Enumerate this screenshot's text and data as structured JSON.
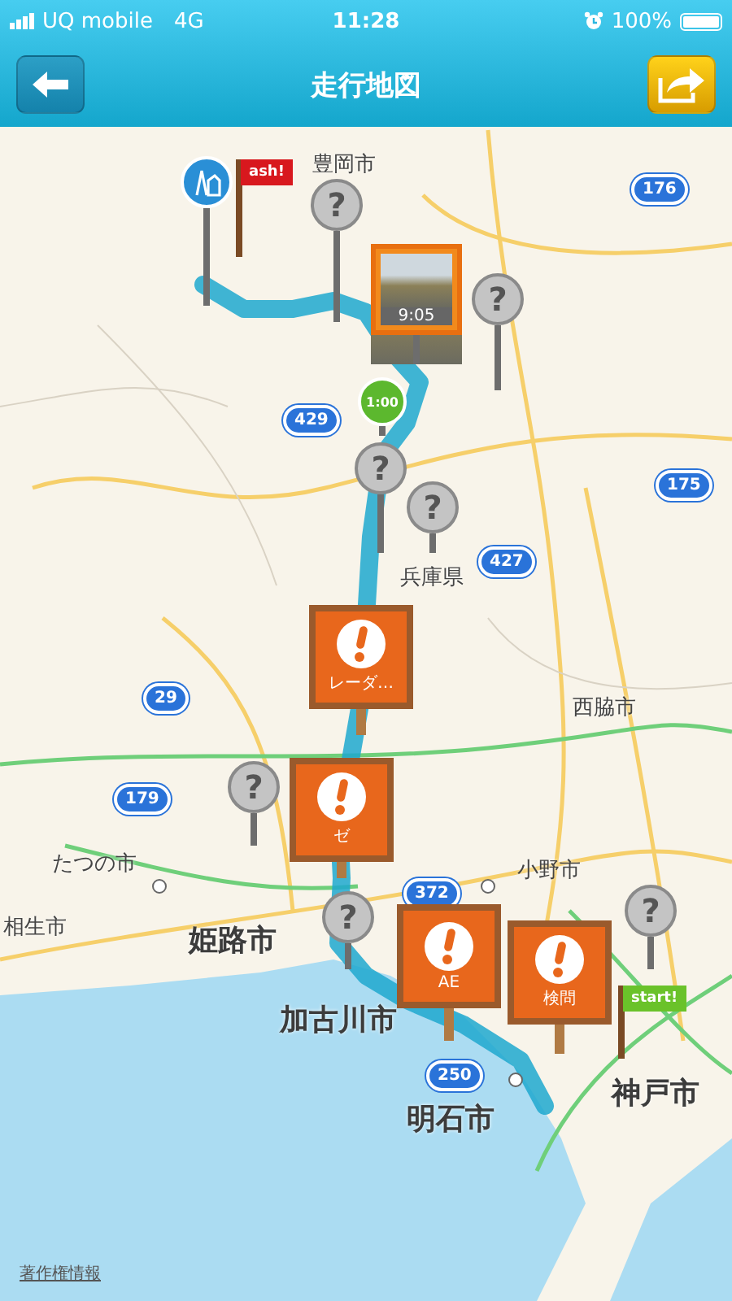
{
  "status_bar": {
    "carrier": "UQ mobile",
    "network": "4G",
    "time": "11:28",
    "battery": "100%"
  },
  "nav": {
    "title": "走行地図"
  },
  "map": {
    "city_labels": [
      "豊岡市",
      "兵庫県",
      "西脇市",
      "たつの市",
      "小野市",
      "相生市",
      "姫路市",
      "加古川市",
      "明石市",
      "神戸市"
    ],
    "route_shields": [
      "176",
      "429",
      "175",
      "427",
      "29",
      "179",
      "372",
      "250"
    ],
    "pins": [
      {
        "kind": "finish-flag",
        "label": "ash!"
      },
      {
        "kind": "tower"
      },
      {
        "kind": "question",
        "label": "?"
      },
      {
        "kind": "photo",
        "label": "9:05"
      },
      {
        "kind": "timer",
        "label": "1:00"
      },
      {
        "kind": "question",
        "label": "?"
      },
      {
        "kind": "alert",
        "label": "レーダ…"
      },
      {
        "kind": "alert",
        "label": "ゼ"
      },
      {
        "kind": "alert",
        "label": "AE"
      },
      {
        "kind": "alert",
        "label": "検問"
      },
      {
        "kind": "start-flag",
        "label": "start!"
      },
      {
        "kind": "question",
        "label": "?"
      },
      {
        "kind": "question",
        "label": "?"
      },
      {
        "kind": "question",
        "label": "?"
      },
      {
        "kind": "question",
        "label": "?"
      },
      {
        "kind": "question",
        "label": "?"
      }
    ],
    "attribution": "著作権情報"
  }
}
